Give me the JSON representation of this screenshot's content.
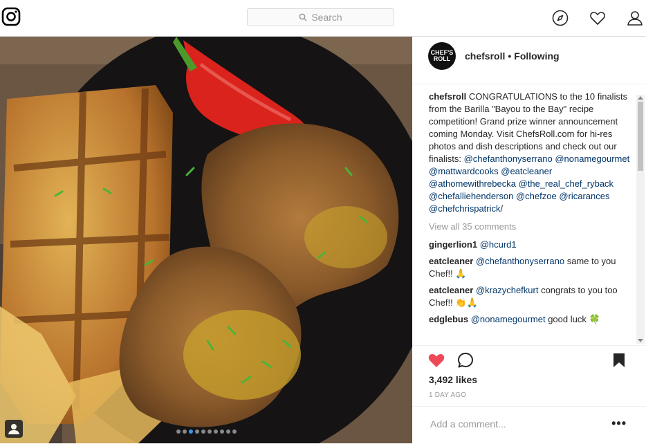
{
  "search": {
    "placeholder": "Search"
  },
  "post": {
    "username": "chefsroll",
    "separator": "•",
    "follow_status": "Following",
    "avatar_text": "CHEF'S ROLL",
    "caption": {
      "user": "chefsroll",
      "text": "CONGRATULATIONS to the 10 finalists from the Barilla \"Bayou to the Bay\" recipe competition! Grand prize winner announcement coming Monday. Visit ChefsRoll.com for hi-res photos and dish descriptions and check out our finalists:",
      "mentions": [
        "@chefanthonyserrano",
        "@nonamegourmet",
        "@mattwardcooks",
        "@eatcleaner",
        "@athomewithrebecka",
        "@the_real_chef_ryback",
        "@chefalliehenderson",
        "@chefzoe",
        "@ricarances",
        "@chefchrispatrick"
      ],
      "trailing": "/"
    },
    "view_all": "View all 35 comments",
    "comments": [
      {
        "user": "gingerlion1",
        "mention": "@hcurd1",
        "text": ""
      },
      {
        "user": "eatcleaner",
        "mention": "@chefanthonyserrano",
        "text": "same to you Chef!! 🙏"
      },
      {
        "user": "eatcleaner",
        "mention": "@krazychefkurt",
        "text": "congrats to you too Chef!! 👏🙏"
      },
      {
        "user": "edglebus",
        "mention": "@nonamegourmet",
        "text": "good luck 🍀"
      }
    ],
    "likes": "3,492 likes",
    "time": "1 DAY AGO",
    "add_comment_placeholder": "Add a comment...",
    "more_label": "•••"
  },
  "carousel": {
    "count": 10,
    "active": 2
  },
  "colors": {
    "heart": "#ed4956",
    "mention": "#003569",
    "accent": "#3897f0"
  },
  "icons": [
    "instagram-logo-icon",
    "search-icon",
    "compass-icon",
    "heart-icon",
    "profile-icon",
    "user-tag-icon",
    "comment-icon",
    "bookmark-icon"
  ]
}
